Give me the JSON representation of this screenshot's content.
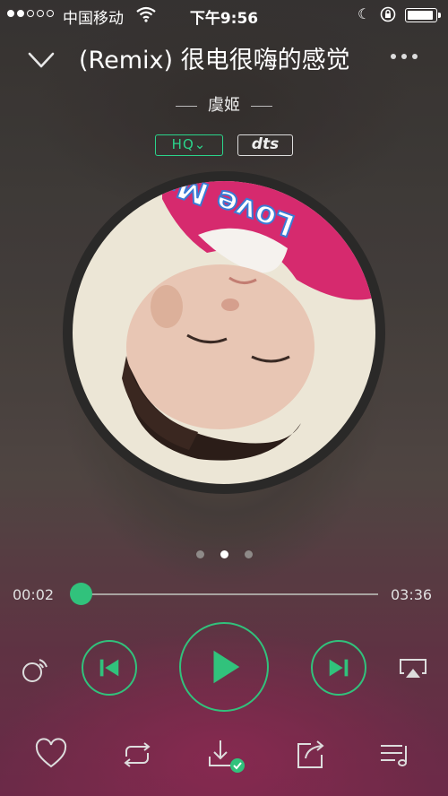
{
  "status_bar": {
    "carrier": "中国移动",
    "time": "下午9:56",
    "signal_bars_filled": 2,
    "signal_bars_total": 5,
    "battery_level": 0.85,
    "icons": [
      "wifi-icon",
      "moon-icon",
      "rotation-lock-icon",
      "battery-icon"
    ]
  },
  "header": {
    "title": "(Remix) 很电很嗨的感觉",
    "artist": "虞姬"
  },
  "badges": {
    "quality": "HQ⌄",
    "dts": "dts"
  },
  "album_art": {
    "caption": "Love Music"
  },
  "pager": {
    "count": 3,
    "active_index": 1
  },
  "progress": {
    "current": "00:02",
    "total": "03:36",
    "fraction": 0.01
  },
  "controls": {
    "icons": [
      "cast-icon",
      "previous-icon",
      "play-icon",
      "next-icon",
      "airplay-icon"
    ]
  },
  "toolbar": {
    "icons": [
      "heart-icon",
      "repeat-icon",
      "download-icon",
      "share-icon",
      "playlist-icon"
    ]
  },
  "colors": {
    "accent": "#31c27c",
    "hq": "#2bd48b"
  }
}
